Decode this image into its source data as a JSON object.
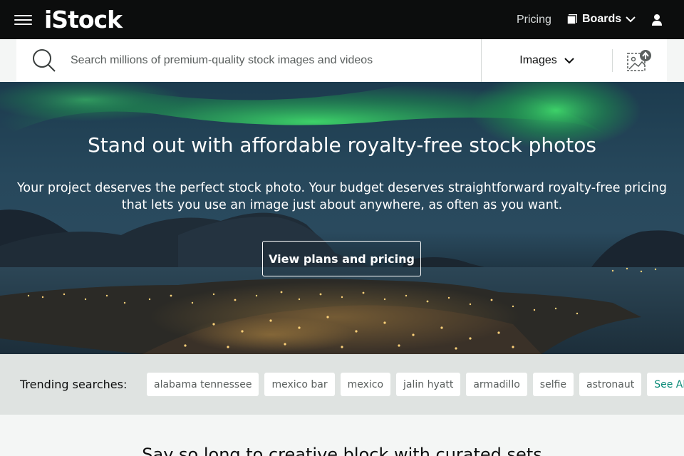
{
  "header": {
    "logo": "iStock",
    "pricing": "Pricing",
    "boards": "Boards"
  },
  "search": {
    "placeholder": "Search millions of premium-quality stock images and videos",
    "media_type": "Images"
  },
  "hero": {
    "title": "Stand out with affordable royalty-free stock photos",
    "subtitle_line1": "Your project deserves the perfect stock photo. Your budget deserves straightforward royalty-free pricing",
    "subtitle_line2": "that lets you use an image just about anywhere, as often as you want.",
    "cta": "View plans and pricing"
  },
  "trending": {
    "label": "Trending searches:",
    "items": [
      "alabama tennessee",
      "mexico bar",
      "mexico",
      "jalin hyatt",
      "armadillo",
      "selfie",
      "astronaut"
    ],
    "see_all": "See All"
  },
  "section": {
    "title": "Say so long to creative block with curated sets"
  },
  "colors": {
    "topbar": "#0c0d0d",
    "accent": "#0a8a77",
    "trending_bg": "#dfe3e1"
  },
  "icons": {
    "menu": "hamburger-icon",
    "boards": "boards-icon",
    "user": "user-icon",
    "search": "search-icon",
    "image_search": "image-search-icon"
  }
}
